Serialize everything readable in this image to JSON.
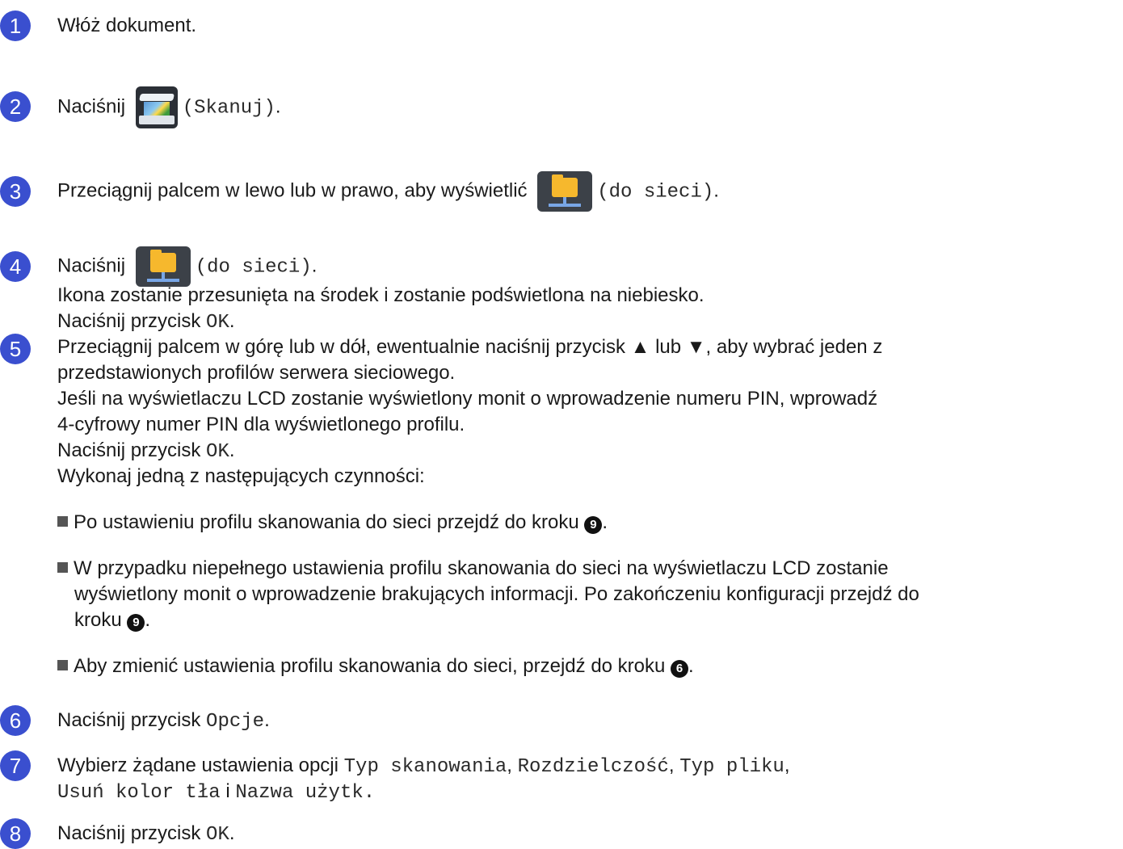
{
  "steps": [
    {
      "num": "1",
      "text": "Włóż dokument."
    },
    {
      "num": "2",
      "pre": "Naciśnij",
      "icon": "scanner-icon",
      "code": "(Skanuj)",
      "post": "."
    },
    {
      "num": "3",
      "pre": "Przeciągnij palcem w lewo lub w prawo, aby wyświetlić",
      "icon": "network-folder-icon",
      "code": "(do sieci)",
      "post": "."
    },
    {
      "num": "4",
      "pre": "Naciśnij",
      "icon": "network-folder-icon",
      "code": "(do sieci)",
      "post": ".",
      "line2": "Ikona zostanie przesunięta na środek i zostanie podświetlona na niebiesko.",
      "line3_pre": "Naciśnij przycisk",
      "line3_code": "OK",
      "line3_post": "."
    },
    {
      "num": "5",
      "lines": [
        "Przeciągnij palcem w górę lub w dół, ewentualnie naciśnij przycisk ▲ lub ▼, aby wybrać jeden z",
        "przedstawionych profilów serwera sieciowego.",
        "Jeśli na wyświetlaczu LCD zostanie wyświetlony monit o wprowadzenie numeru PIN, wprowadź",
        "4-cyfrowy numer PIN dla wyświetlonego profilu."
      ],
      "ok_pre": "Naciśnij przycisk",
      "ok_code": "OK",
      "ok_post": ".",
      "intro": "Wykonaj jedną z następujących czynności:",
      "bullets": [
        {
          "text": "Po ustawieniu profilu skanowania do sieci przejdź do kroku",
          "ref": "9",
          "post": "."
        },
        {
          "text": "W przypadku niepełnego ustawienia profilu skanowania do sieci na wyświetlaczu LCD zostanie",
          "text2": "wyświetlony monit o wprowadzenie brakujących informacji. Po zakończeniu konfiguracji przejdź do",
          "text3": "kroku",
          "ref": "9",
          "post": "."
        },
        {
          "text": "Aby zmienić ustawienia profilu skanowania do sieci, przejdź do kroku",
          "ref": "6",
          "post": "."
        }
      ]
    },
    {
      "num": "6",
      "pre": "Naciśnij przycisk",
      "code": "Opcje",
      "post": "."
    },
    {
      "num": "7",
      "pre": "Wybierz żądane ustawienia opcji",
      "opt1": "Typ skanowania",
      "sep1": ",",
      "opt2": "Rozdzielczość",
      "sep2": ",",
      "opt3": "Typ pliku",
      "sep3": ",",
      "opt4": "Usuń kolor tła",
      "conj": "i",
      "opt5": "Nazwa użytk",
      "post": "."
    },
    {
      "num": "8",
      "pre": "Naciśnij przycisk",
      "code": "OK",
      "post": "."
    }
  ],
  "colors": {
    "badge": "#3a4fcf",
    "text": "#1a1a1a"
  }
}
